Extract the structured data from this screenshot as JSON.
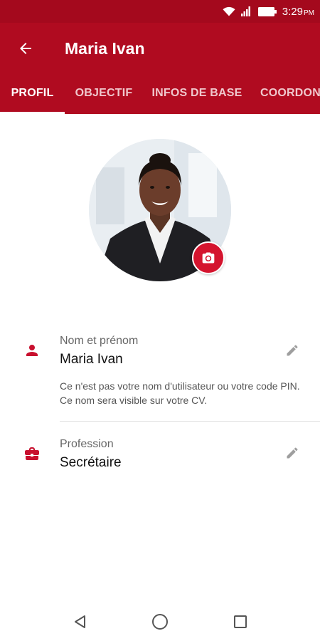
{
  "status_bar": {
    "time": "3:29",
    "ampm": "PM",
    "icons": [
      "wifi-icon",
      "signal-icon",
      "battery-icon"
    ]
  },
  "app_bar": {
    "title": "Maria Ivan",
    "back_icon": "arrow-left-icon"
  },
  "tabs": [
    {
      "label": "PROFIL",
      "active": true
    },
    {
      "label": "OBJECTIF",
      "active": false
    },
    {
      "label": "INFOS DE BASE",
      "active": false
    },
    {
      "label": "COORDONNÉES",
      "active": false
    }
  ],
  "profile": {
    "camera_icon": "camera-icon"
  },
  "fields": {
    "name": {
      "icon": "person-icon",
      "label": "Nom et prénom",
      "value": "Maria Ivan",
      "help": "Ce n'est pas votre nom d'utilisateur ou votre code PIN. Ce nom sera visible sur votre CV.",
      "edit_icon": "pencil-icon"
    },
    "profession": {
      "icon": "briefcase-icon",
      "label": "Profession",
      "value": "Secrétaire",
      "edit_icon": "pencil-icon"
    }
  },
  "nav_bar": {
    "icons": [
      "back-triangle-icon",
      "home-circle-icon",
      "recents-square-icon"
    ]
  },
  "colors": {
    "primary": "#b00b20",
    "status_bar": "#a4091d",
    "accent": "#d4142e"
  }
}
